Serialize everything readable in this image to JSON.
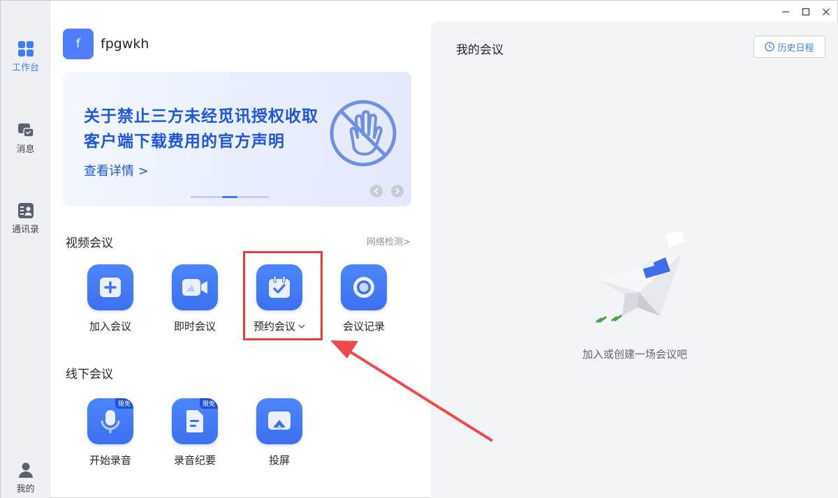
{
  "rail": {
    "items": [
      {
        "label": "工作台",
        "icon": "grid-icon",
        "active": true
      },
      {
        "label": "消息",
        "icon": "chat-icon"
      },
      {
        "label": "通讯录",
        "icon": "contacts-icon"
      },
      {
        "label": "我的",
        "icon": "person-icon"
      }
    ]
  },
  "window_controls": {
    "minimize": "minimize-icon",
    "maximize": "maximize-icon",
    "close": "close-icon"
  },
  "user": {
    "avatar_letter": "f",
    "name": "fpgwkh"
  },
  "banner": {
    "title": "关于禁止三方未经觅讯授权收取客户端下载费用的官方声明",
    "link": "查看详情 >"
  },
  "video_meetings": {
    "title": "视频会议",
    "network_check": "网络检测>",
    "tiles": [
      {
        "label": "加入会议",
        "icon": "plus-icon"
      },
      {
        "label": "即时会议",
        "icon": "video-camera-icon"
      },
      {
        "label": "预约会议",
        "icon": "calendar-check-icon",
        "dropdown": "chevron-down-icon"
      },
      {
        "label": "会议记录",
        "icon": "record-icon"
      }
    ]
  },
  "offline_meetings": {
    "title": "线下会议",
    "tiles": [
      {
        "label": "开始录音",
        "icon": "microphone-icon",
        "badge": "限免"
      },
      {
        "label": "录音纪要",
        "icon": "document-icon",
        "badge": "限免"
      },
      {
        "label": "投屏",
        "icon": "cast-screen-icon"
      }
    ]
  },
  "right_panel": {
    "title": "我的会议",
    "history_button": "历史日程",
    "empty_text": "加入或创建一场会议吧"
  },
  "colors": {
    "accent": "#3d7bff",
    "annotation": "#ef3b3b"
  }
}
